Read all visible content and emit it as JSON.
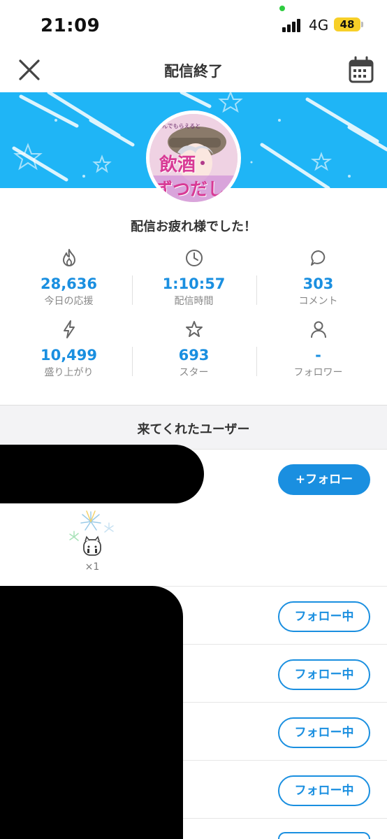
{
  "status_bar": {
    "time": "21:09",
    "network": "4G",
    "battery": "48"
  },
  "nav": {
    "title": "配信終了",
    "close_icon": "close-icon",
    "calendar_icon": "calendar-icon"
  },
  "banner": {
    "avatar_text_line1": "飲酒",
    "avatar_text_line2": "ずつだし"
  },
  "greeting": "配信お疲れ様でした！",
  "stats": [
    {
      "icon": "flame-icon",
      "value": "28,636",
      "label": "今日の応援"
    },
    {
      "icon": "clock-icon",
      "value": "1:10:57",
      "label": "配信時間"
    },
    {
      "icon": "comment-icon",
      "value": "303",
      "label": "コメント"
    },
    {
      "icon": "lightning-icon",
      "value": "10,499",
      "label": "盛り上がり"
    },
    {
      "icon": "star-icon",
      "value": "693",
      "label": "スター"
    },
    {
      "icon": "person-icon",
      "value": "-",
      "label": "フォロワー"
    }
  ],
  "section": {
    "title": "来てくれたユーザー"
  },
  "users": {
    "follow_label": "+フォロー",
    "following_label": "フォロー中",
    "gift_count": "×1"
  },
  "colors": {
    "accent": "#1a8fe0",
    "banner": "#1fb5f6"
  }
}
